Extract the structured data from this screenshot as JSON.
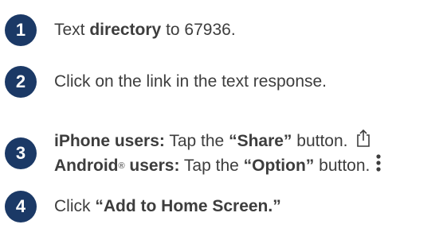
{
  "steps": [
    {
      "number": "1",
      "prefix": "Text ",
      "bold": "directory",
      "suffix": " to 67936."
    },
    {
      "number": "2",
      "text": "Click on the link in the text response."
    },
    {
      "number": "3",
      "iphone": {
        "label": "iPhone users:",
        "mid": " Tap the ",
        "button": "“Share”",
        "suffix": " button.",
        "icon": "share-icon"
      },
      "android": {
        "brand": "Android",
        "reg": "®",
        "label": " users:",
        "mid": " Tap the ",
        "button": "“Option”",
        "suffix": " button.",
        "icon": "vertical-dots-icon"
      }
    },
    {
      "number": "4",
      "prefix": "Click ",
      "bold": "“Add to Home Screen.”"
    }
  ],
  "colors": {
    "badge": "#1b3966",
    "text": "#3d3d3d"
  }
}
